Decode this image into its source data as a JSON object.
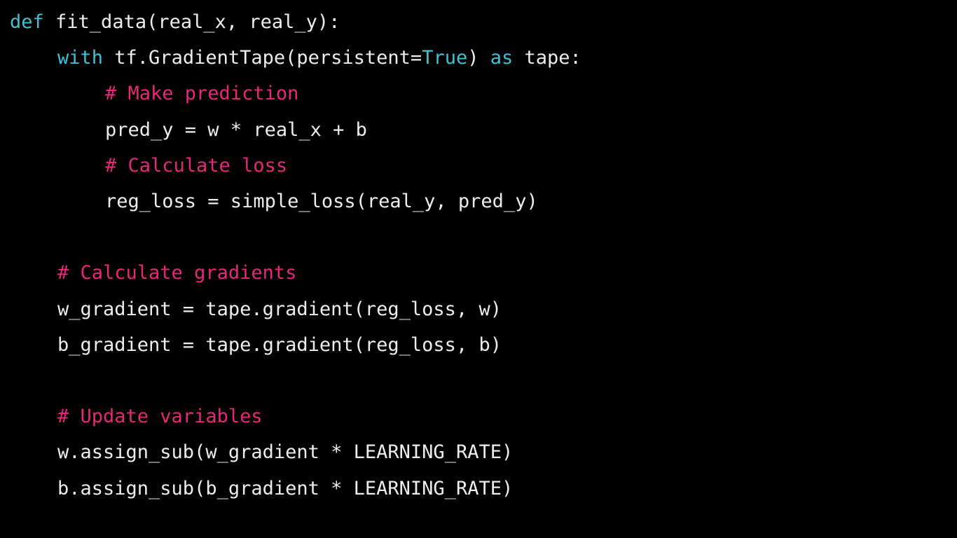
{
  "colors": {
    "background": "#000000",
    "text": "#ededed",
    "keyword": "#3fc1d6",
    "comment": "#e8267a"
  },
  "code": {
    "language": "python",
    "lines": [
      {
        "indent": 0,
        "tokens": [
          {
            "t": "kw",
            "v": "def"
          },
          {
            "t": "plain",
            "v": " fit_data(real_x, real_y):"
          }
        ]
      },
      {
        "indent": 1,
        "tokens": [
          {
            "t": "kw",
            "v": "with"
          },
          {
            "t": "plain",
            "v": " tf.GradientTape(persistent="
          },
          {
            "t": "kw",
            "v": "True"
          },
          {
            "t": "plain",
            "v": ") "
          },
          {
            "t": "kw",
            "v": "as"
          },
          {
            "t": "plain",
            "v": " tape:"
          }
        ]
      },
      {
        "indent": 2,
        "tokens": [
          {
            "t": "comment",
            "v": "# Make prediction"
          }
        ]
      },
      {
        "indent": 2,
        "tokens": [
          {
            "t": "plain",
            "v": "pred_y = w * real_x + b"
          }
        ]
      },
      {
        "indent": 2,
        "tokens": [
          {
            "t": "comment",
            "v": "# Calculate loss"
          }
        ]
      },
      {
        "indent": 2,
        "tokens": [
          {
            "t": "plain",
            "v": "reg_loss = simple_loss(real_y, pred_y)"
          }
        ]
      },
      {
        "indent": 0,
        "tokens": []
      },
      {
        "indent": 1,
        "tokens": [
          {
            "t": "comment",
            "v": "# Calculate gradients"
          }
        ]
      },
      {
        "indent": 1,
        "tokens": [
          {
            "t": "plain",
            "v": "w_gradient = tape.gradient(reg_loss, w)"
          }
        ]
      },
      {
        "indent": 1,
        "tokens": [
          {
            "t": "plain",
            "v": "b_gradient = tape.gradient(reg_loss, b)"
          }
        ]
      },
      {
        "indent": 0,
        "tokens": []
      },
      {
        "indent": 1,
        "tokens": [
          {
            "t": "comment",
            "v": "# Update variables"
          }
        ]
      },
      {
        "indent": 1,
        "tokens": [
          {
            "t": "plain",
            "v": "w.assign_sub(w_gradient * LEARNING_RATE)"
          }
        ]
      },
      {
        "indent": 1,
        "tokens": [
          {
            "t": "plain",
            "v": "b.assign_sub(b_gradient * LEARNING_RATE)"
          }
        ]
      }
    ]
  }
}
